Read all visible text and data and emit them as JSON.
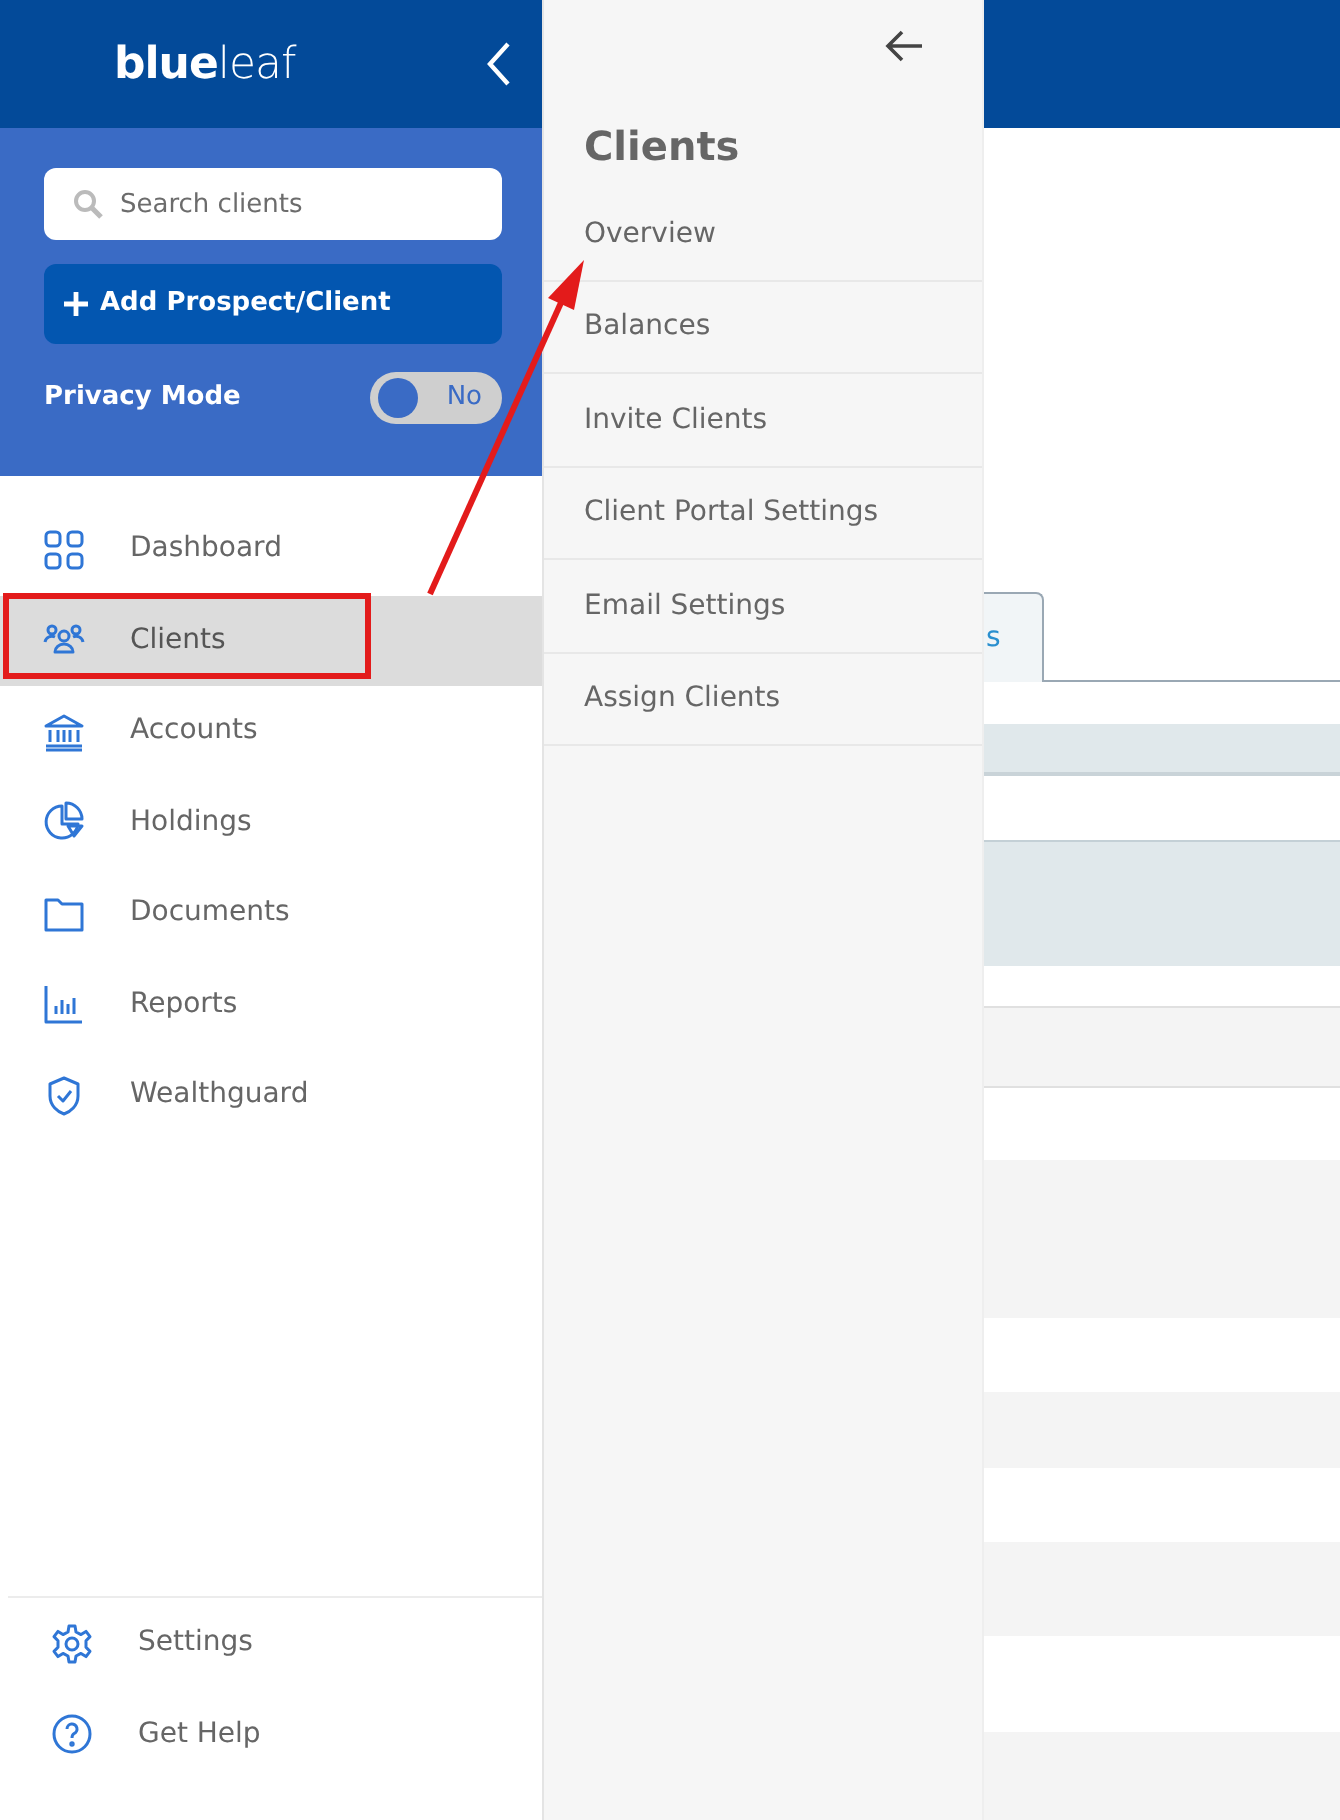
{
  "sidebar": {
    "logo": "**blue**leaf",
    "search": {
      "placeholder": "Search clients"
    },
    "add_button": "Add Prospect/Client",
    "privacy": {
      "label": "Privacy Mode",
      "on": false,
      "state_text": "No"
    },
    "nav_items": [
      {
        "label": "Dashboard",
        "selected": false
      },
      {
        "label": "Clients",
        "selected": true
      },
      {
        "label": "Accounts",
        "selected": false
      },
      {
        "label": "Holdings",
        "selected": false
      },
      {
        "label": "Documents",
        "selected": false
      },
      {
        "label": "Reports",
        "selected": false
      },
      {
        "label": "Wealthguard",
        "selected": false
      }
    ],
    "footer_items": [
      {
        "label": "Settings",
        "selected": false
      },
      {
        "label": "Get Help",
        "selected": false
      }
    ]
  },
  "flyout": {
    "title": "Clients",
    "items": [
      {
        "label": "Overview"
      },
      {
        "label": "Balances"
      },
      {
        "label": "Invite Clients"
      },
      {
        "label": "Client Portal Settings"
      },
      {
        "label": "Email Settings"
      },
      {
        "label": "Assign Clients"
      }
    ]
  },
  "main": {
    "tab": {
      "label": "s"
    }
  }
}
